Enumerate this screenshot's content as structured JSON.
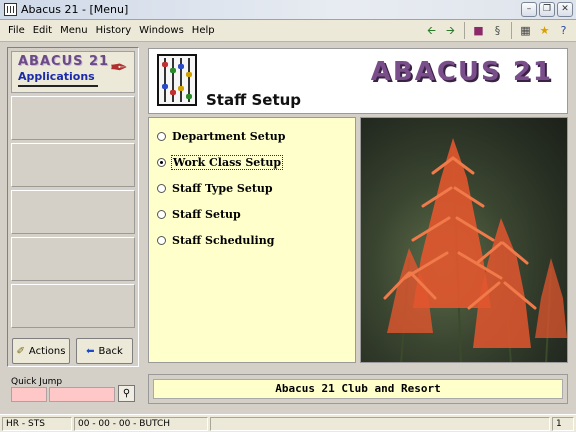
{
  "window": {
    "title": "Abacus 21 - [Menu]"
  },
  "menubar": {
    "items": [
      "File",
      "Edit",
      "Menu",
      "History",
      "Windows",
      "Help"
    ]
  },
  "toolbar": {
    "icons": [
      "back-arrow-icon",
      "forward-arrow-icon",
      "book-icon",
      "note-icon",
      "calculator-icon",
      "run-icon",
      "help-icon"
    ]
  },
  "sidebar": {
    "logo_line1": "ABACUS 21",
    "logo_line2": "Applications",
    "actions_label": "Actions",
    "back_label": "Back",
    "quick_jump_label": "Quick Jump"
  },
  "header": {
    "page_title": "Staff Setup",
    "brand": "ABACUS 21"
  },
  "options": [
    {
      "label": "Department Setup",
      "selected": false
    },
    {
      "label": "Work Class Setup",
      "selected": true
    },
    {
      "label": "Staff Type Setup",
      "selected": false
    },
    {
      "label": "Staff Setup",
      "selected": false
    },
    {
      "label": "Staff Scheduling",
      "selected": false
    }
  ],
  "footer": {
    "text": "Abacus 21 Club and Resort"
  },
  "status": {
    "left": "HR - STS",
    "middle": "00 - 00 - 00 - BUTCH",
    "right": "1"
  },
  "colors": {
    "panel_bg": "#ffffcc",
    "brand_purple": "#7a4e8a",
    "quick_jump_field": "#ffc8c8"
  }
}
